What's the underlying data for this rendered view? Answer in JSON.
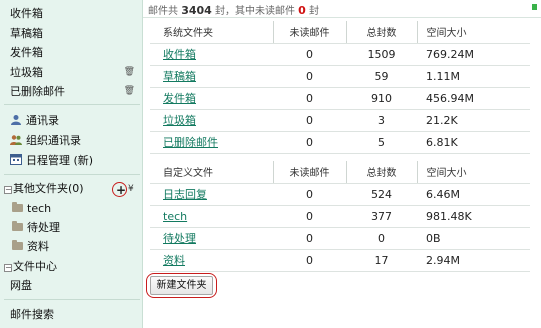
{
  "sidebar": {
    "system_folders": [
      {
        "label": "收件箱"
      },
      {
        "label": "草稿箱"
      },
      {
        "label": "发件箱"
      },
      {
        "label": "垃圾箱",
        "trash_icon": "trash-icon"
      },
      {
        "label": "已删除邮件",
        "trash_icon": "trash-icon"
      }
    ],
    "tools": [
      {
        "label": "通讯录",
        "icon": "contacts-icon"
      },
      {
        "label": "组织通讯录",
        "icon": "org-contacts-icon"
      },
      {
        "label": "日程管理 (新)",
        "icon": "calendar-icon"
      }
    ],
    "other_folders": {
      "toggle": "−",
      "label": "其他文件夹(0)",
      "add": "+",
      "manage": "¥"
    },
    "custom_folders": [
      {
        "label": "tech"
      },
      {
        "label": "待处理"
      },
      {
        "label": "资料"
      }
    ],
    "file_center": {
      "toggle": "−",
      "label": "文件中心"
    },
    "netdisk": {
      "label": "网盘"
    },
    "mail_search": {
      "label": "邮件搜索"
    }
  },
  "summary": {
    "prefix": "邮件共 ",
    "total": "3404",
    "mid": " 封，其中未读邮件 ",
    "unread": "0",
    "suffix": " 封"
  },
  "system_table": {
    "headers": [
      "系统文件夹",
      "未读邮件",
      "总封数",
      "空间大小"
    ],
    "rows": [
      {
        "name": "收件箱",
        "unread": "0",
        "total": "1509",
        "size": "769.24M"
      },
      {
        "name": "草稿箱",
        "unread": "0",
        "total": "59",
        "size": "1.11M"
      },
      {
        "name": "发件箱",
        "unread": "0",
        "total": "910",
        "size": "456.94M"
      },
      {
        "name": "垃圾箱",
        "unread": "0",
        "total": "3",
        "size": "21.2K"
      },
      {
        "name": "已删除邮件",
        "unread": "0",
        "total": "5",
        "size": "6.81K"
      }
    ]
  },
  "custom_table": {
    "headers": [
      "自定义文件",
      "未读邮件",
      "总封数",
      "空间大小"
    ],
    "rows": [
      {
        "name": "日志回复",
        "unread": "0",
        "total": "524",
        "size": "6.46M"
      },
      {
        "name": "tech",
        "unread": "0",
        "total": "377",
        "size": "981.48K"
      },
      {
        "name": "待处理",
        "unread": "0",
        "total": "0",
        "size": "0B"
      },
      {
        "name": "资料",
        "unread": "0",
        "total": "17",
        "size": "2.94M"
      }
    ]
  },
  "new_folder_button": "新建文件夹",
  "colors": {
    "sidebar_bg": "#e6f4ee",
    "link": "#137a60",
    "highlight_ring": "#c81d1d",
    "unread_count": "#d01010"
  }
}
